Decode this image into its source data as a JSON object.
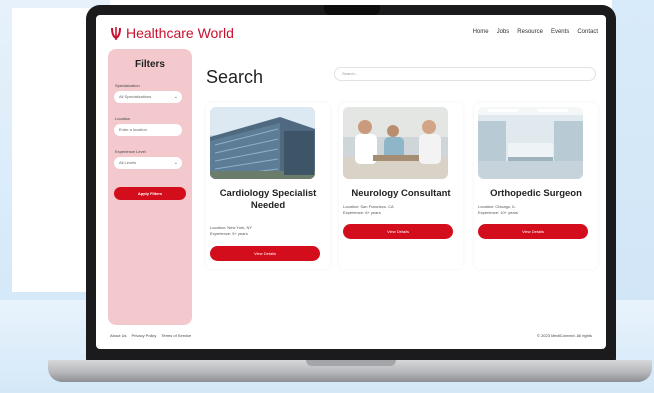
{
  "header": {
    "brand": "Healthcare World",
    "nav": [
      "Home",
      "Jobs",
      "Resource",
      "Events",
      "Contact"
    ]
  },
  "filters": {
    "title": "Filters",
    "specialization_label": "Specialization",
    "specialization_value": "All Specializations",
    "location_label": "Location",
    "location_placeholder": "Enter a location",
    "experience_label": "Experience Level",
    "experience_value": "All Levels",
    "apply_label": "Apply Filters"
  },
  "main": {
    "title": "Search",
    "search_placeholder": "Search..."
  },
  "jobs": [
    {
      "title": "Cardiology Specialist Needed",
      "location": "Location: New York, NY",
      "experience": "Experience: 5+ years",
      "button": "View Details"
    },
    {
      "title": "Neurology Consultant",
      "location": "Location: San Francisco, CA",
      "experience": "Experience: 8+ years",
      "button": "View Details"
    },
    {
      "title": "Orthopedic Surgeon",
      "location": "Location: Chicago, IL",
      "experience": "Experience: 10+ years",
      "button": "View Details"
    }
  ],
  "footer": {
    "links": [
      "About Us",
      "Privacy Policy",
      "Terms of Service"
    ],
    "copyright": "© 2023 MediConnect. All rights"
  },
  "colors": {
    "accent": "#d40d1d",
    "sidebar": "#f3c9cd"
  }
}
